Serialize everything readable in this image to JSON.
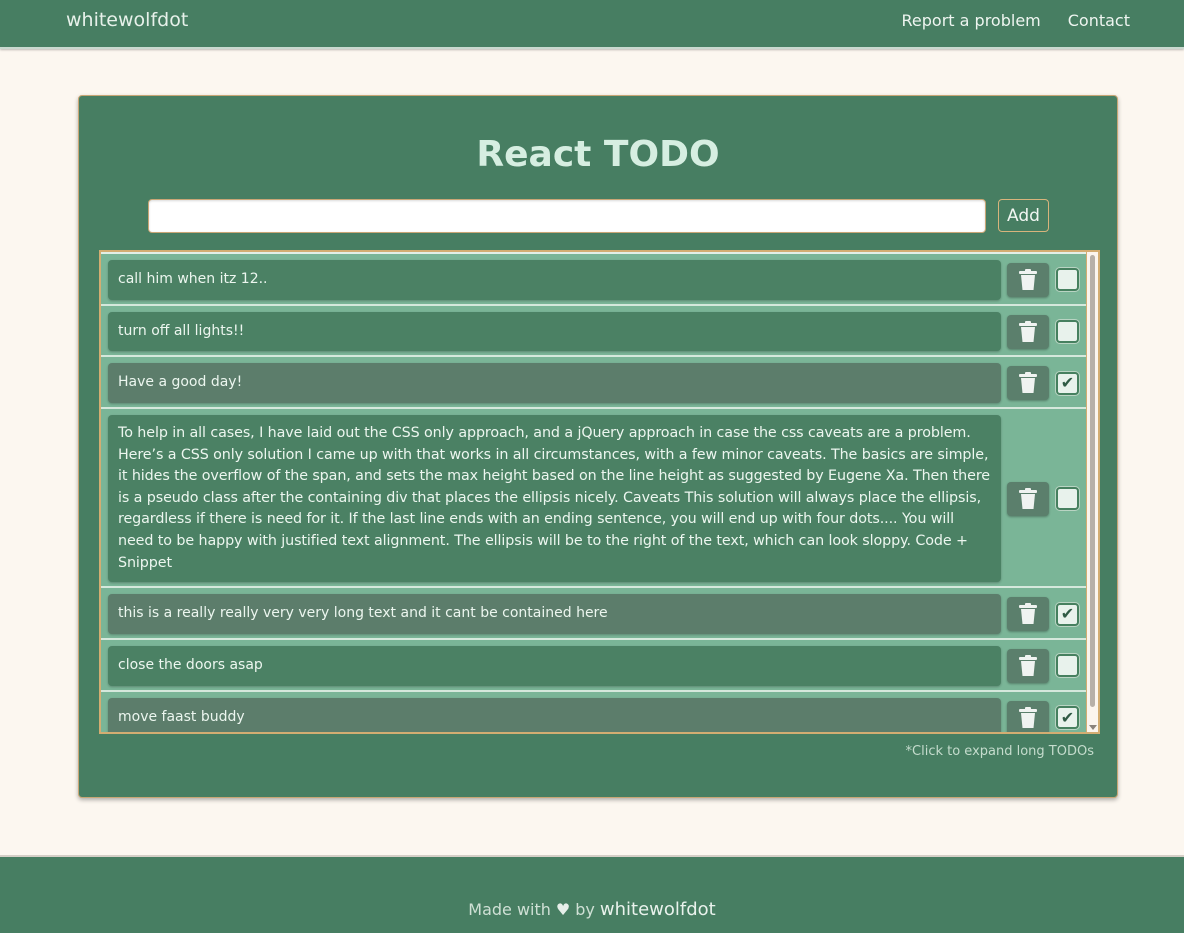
{
  "navbar": {
    "brand": "whitewolfdot",
    "links": [
      "Report a problem",
      "Contact"
    ]
  },
  "app": {
    "title": "React TODO",
    "input": {
      "value": "",
      "placeholder": ""
    },
    "add_label": "Add",
    "todos": [
      {
        "text": "call him when itz 12..",
        "done": false
      },
      {
        "text": "turn off all lights!!",
        "done": false
      },
      {
        "text": "Have a good day!",
        "done": true
      },
      {
        "text": "To help in all cases, I have laid out the CSS only approach, and a jQuery approach in case the css caveats are a problem. Here’s a CSS only solution I came up with that works in all circumstances, with a few minor caveats. The basics are simple, it hides the overflow of the span, and sets the max height based on the line height as suggested by Eugene Xa. Then there is a pseudo class after the containing div that places the ellipsis nicely. Caveats This solution will always place the ellipsis, regardless if there is need for it. If the last line ends with an ending sentence, you will end up with four dots.... You will need to be happy with justified text alignment. The ellipsis will be to the right of the text, which can look sloppy. Code + Snippet",
        "done": false,
        "expanded": true
      },
      {
        "text": "this is a really really very very long text and it cant be contained here",
        "done": true
      },
      {
        "text": "close the doors asap",
        "done": false
      },
      {
        "text": "move faast buddy",
        "done": true
      }
    ],
    "hint": "*Click to expand long TODOs"
  },
  "footer": {
    "made_with": "Made with",
    "by": "by",
    "brand": "whitewolfdot"
  },
  "icons": {
    "delete": "trash-icon",
    "heart": "heart-icon",
    "check": "checkmark-icon"
  },
  "colors": {
    "primary": "#477e62",
    "accent_border": "#d3ad72",
    "background": "#fcf7f0"
  }
}
